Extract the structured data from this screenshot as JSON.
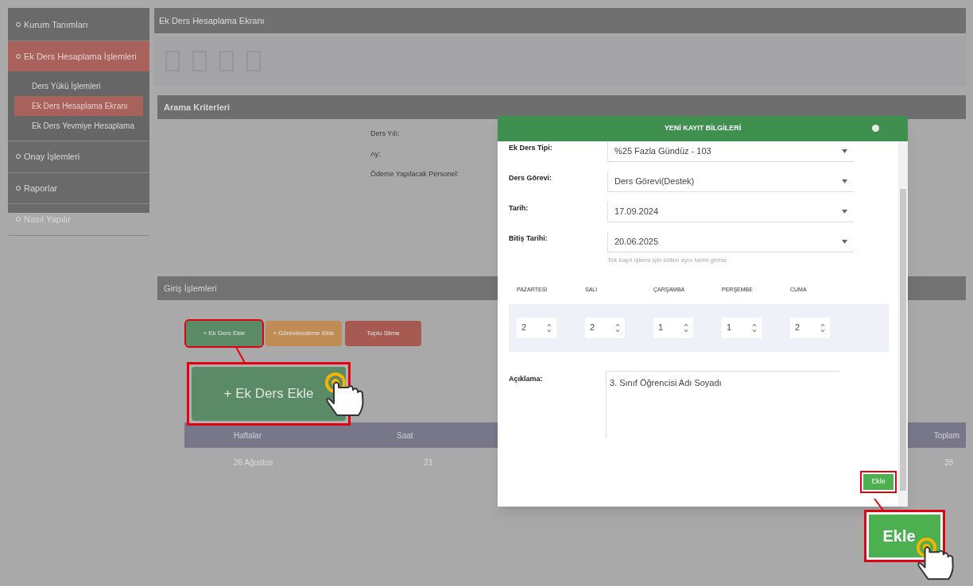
{
  "sidebar": {
    "items": [
      {
        "label": "Kurum Tanımları",
        "selected": false
      },
      {
        "label": "Ek Ders Hesaplama İşlemleri",
        "selected": true,
        "children": [
          {
            "label": "Ders Yükü İşlemleri",
            "selected": false
          },
          {
            "label": "Ek Ders Hesaplama Ekranı",
            "selected": true
          },
          {
            "label": "Ek Ders Yevmiye Hesaplama",
            "selected": false
          }
        ]
      },
      {
        "label": "Onay İşlemleri",
        "selected": false
      },
      {
        "label": "Raporlar",
        "selected": false
      },
      {
        "label": "Nasıl Yapılır",
        "selected": false
      }
    ]
  },
  "page_title": "Ek Ders Hesaplama Ekranı",
  "search": {
    "title": "Arama Kriterleri",
    "labels": [
      "Ders Yılı:",
      "Ay:",
      "Ödeme Yapılacak Personel:"
    ]
  },
  "entry": {
    "title": "Giriş İşlemleri",
    "buttons": [
      {
        "label": "+ Ek Ders Ekle",
        "color": "#5b8a66",
        "highlighted": true
      },
      {
        "label": "+ Görevlendirme Ekle",
        "color": "#c08c55",
        "highlighted": false
      },
      {
        "label": "Toplu Silme",
        "color": "#a65a52",
        "highlighted": false
      }
    ],
    "table": {
      "columns": [
        "Haftalar",
        "Saat",
        "Toplam"
      ],
      "rows": [
        [
          "26 Ağustos",
          "21",
          "38"
        ]
      ]
    }
  },
  "dialog": {
    "title": "YENİ KAYIT BİLGİLERİ",
    "fields": [
      {
        "label": "Ek Ders Tipi:",
        "value": "%25 Fazla Gündüz - 103"
      },
      {
        "label": "Ders Görevi:",
        "value": "Ders Görevi(Destek)"
      },
      {
        "label": "Tarih:",
        "value": "17.09.2024"
      },
      {
        "label": "Bitiş Tarihi:",
        "value": "20.06.2025",
        "hint": "Tek kayıt işlemi için lütfen aynı tarihi giriniz"
      }
    ],
    "days": [
      {
        "label": "PAZARTESİ",
        "value": "2"
      },
      {
        "label": "SALI",
        "value": "2"
      },
      {
        "label": "ÇARŞAMBA",
        "value": "1"
      },
      {
        "label": "PERŞEMBE",
        "value": "1"
      },
      {
        "label": "CUMA",
        "value": "2"
      }
    ],
    "note": {
      "label": "Açıklama:",
      "value": "3. Sınıf Öğrencisi Adı Soyadı"
    },
    "submit": {
      "label": "Ekle",
      "highlighted": true
    }
  },
  "callouts": [
    {
      "label": "+ Ek Ders Ekle"
    },
    {
      "label": "Ekle"
    }
  ]
}
